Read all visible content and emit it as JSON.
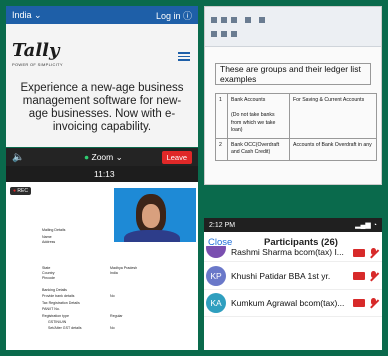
{
  "tally_site": {
    "country": "India",
    "login": "Log in",
    "brand": "Tally",
    "tagline": "POWER OF SIMPLICITY",
    "promo": "Experience a new-age business management software for new-age businesses. Now with e-invoicing capability."
  },
  "document": {
    "banner": "These are groups and their ledger list examples",
    "rows": [
      {
        "no": "1",
        "group": "Bank Accounts\n\n(Do not take banks from which we take loan)",
        "desc": "For Saving & Current Accounts"
      },
      {
        "no": "2",
        "group": "Bank OCC(Overdraft and Cash Credit)",
        "desc": "Accounts of Bank Overdraft in any"
      }
    ]
  },
  "zoom": {
    "app": "Zoom",
    "leave": "Leave",
    "time": "11:13",
    "rec": "REC",
    "form": {
      "mailing": "Mailing Details",
      "name": "Name",
      "address": "Address",
      "state": "State",
      "state_val": "Madhya Pradesh",
      "country": "Country",
      "country_val": "India",
      "pincode": "Pincode",
      "banking": "Banking Details",
      "provide_bank": "Provide bank details",
      "provide_bank_val": "No",
      "tax": "Tax Registration Details",
      "pan": "PAN/IT No.",
      "reg_type": "Registration type",
      "reg_type_val": "Regular",
      "gstin": "GSTIN/UIN",
      "other_gst": "Set/Alter GST details",
      "other_gst_val": "No"
    }
  },
  "participants": {
    "clock": "2:12 PM",
    "close": "Close",
    "title": "Participants (26)",
    "list": [
      {
        "initials": "",
        "name": "Rashmi Sharma bcom(tax) I...",
        "color": "#7a4fb0"
      },
      {
        "initials": "KP",
        "name": "Khushi Patidar BBA 1st yr.",
        "color": "#6a78c9"
      },
      {
        "initials": "KA",
        "name": "Kumkum Agrawal bcom(tax)...",
        "color": "#2f9fbf"
      }
    ]
  }
}
